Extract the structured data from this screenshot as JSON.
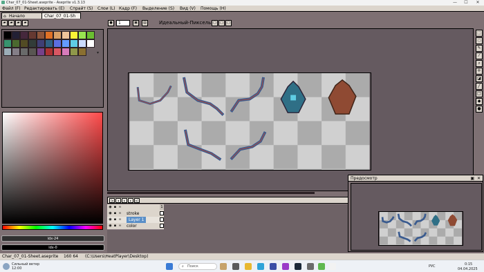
{
  "window": {
    "title": "Char_07_01-Sheet.aseprite - Aseprite v1.3.13",
    "controls": [
      "—",
      "☐",
      "✕"
    ]
  },
  "menu": [
    {
      "label": "Файл (F)"
    },
    {
      "label": "Редактировать (E)"
    },
    {
      "label": "Спрайт (S)"
    },
    {
      "label": "Слои (L)"
    },
    {
      "label": "Кадр (F)"
    },
    {
      "label": "Выделение (S)"
    },
    {
      "label": "Вид (V)"
    },
    {
      "label": "Помощь (H)"
    }
  ],
  "tabs": [
    {
      "label": "Начало",
      "icon": "home-icon",
      "active": false
    },
    {
      "label": "Char_07_01-Sh",
      "icon": "",
      "active": true
    }
  ],
  "toolbar": {
    "brush_size": "1",
    "pixel_mode_label": "Идеальный-Пиксель"
  },
  "palette_colors": [
    "#000000",
    "#222034",
    "#45283c",
    "#663931",
    "#8f563b",
    "#df7126",
    "#d9a066",
    "#eec39a",
    "#fbf236",
    "#99e550",
    "#6abe30",
    "#37946e",
    "#4b692f",
    "#524b24",
    "#323c39",
    "#3f3f74",
    "#306082",
    "#5b6ee1",
    "#639bff",
    "#5fcde4",
    "#cbdbfc",
    "#ffffff",
    "#9badb7",
    "#847e87",
    "#696a6a",
    "#595652",
    "#76428a",
    "#ac3232",
    "#d95763",
    "#d77bba",
    "#8f974a",
    "#8a6f30"
  ],
  "colors": {
    "foreground_label": "idx-24",
    "background_label": "idx-0",
    "accent": "#ff4a4a"
  },
  "layers": [
    {
      "name": "",
      "frame": "1"
    },
    {
      "name": "stroke",
      "frame": ""
    },
    {
      "name": "Layer 1",
      "frame": ""
    },
    {
      "name": "color",
      "frame": ""
    }
  ],
  "status": {
    "filename": "Char_07_01-Sheet.aseprite",
    "dimensions": "160 64",
    "path": "(C:\\Users\\HeatPlayer\\Desktop)"
  },
  "preview": {
    "title": "Предосмотр"
  },
  "taskbar": {
    "weather_line1": "Сильный ветер",
    "weather_line2": "12:00",
    "search_placeholder": "Поиск",
    "language": "РУС",
    "time": "0:15",
    "date": "04.04.2025"
  }
}
